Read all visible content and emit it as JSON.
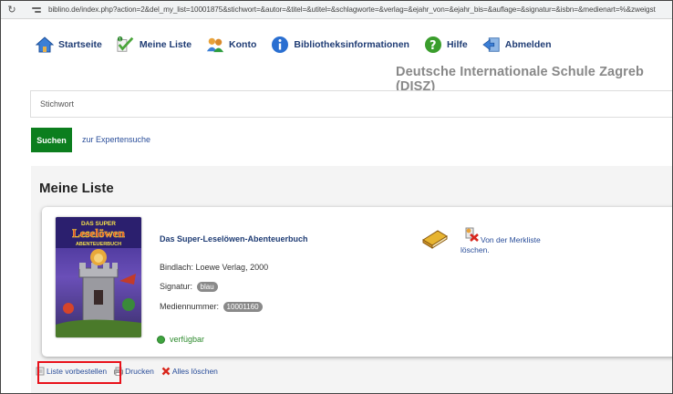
{
  "browser": {
    "url": "biblino.de/index.php?action=2&del_my_list=10001875&stichwort=&autor=&titel=&utitel=&schlagworte=&verlag=&ejahr_von=&ejahr_bis=&auflage=&signatur=&isbn=&medienart=%&zweigst"
  },
  "nav": {
    "items": [
      {
        "label": "Startseite",
        "icon": "home-icon"
      },
      {
        "label": "Meine Liste",
        "icon": "list-icon"
      },
      {
        "label": "Konto",
        "icon": "account-icon"
      },
      {
        "label": "Bibliotheksinformationen",
        "icon": "info-icon"
      },
      {
        "label": "Hilfe",
        "icon": "help-icon"
      },
      {
        "label": "Abmelden",
        "icon": "logout-icon"
      }
    ],
    "school_name": "Deutsche Internationale Schule Zagreb (DISZ)"
  },
  "search": {
    "placeholder": "Stichwort",
    "button_label": "Suchen",
    "expert_link": "zur Expertensuche"
  },
  "list": {
    "title": "Meine Liste",
    "item": {
      "title": "Das Super-Leselöwen-Abenteuerbuch",
      "publisher": "Bindlach: Loewe Verlag, 2000",
      "signature_label": "Signatur:",
      "signature_value": "blau",
      "media_number_label": "Mediennummer:",
      "media_number_value": "10001160",
      "status": "verfügbar",
      "remove_label": "Von der Merkliste löschen.",
      "cover": {
        "line1": "DAS SUPER",
        "line2": "Leselöwen",
        "line3": "ABENTEUERBUCH"
      }
    }
  },
  "actions": {
    "reserve": "Liste vorbestellen",
    "print": "Drucken",
    "delete_all": "Alles löschen"
  },
  "colors": {
    "accent": "#1f3c74",
    "link": "#2a4e9a",
    "search_button": "#0c7e1e",
    "highlight": "#e8111a",
    "available": "#3ea43e"
  }
}
